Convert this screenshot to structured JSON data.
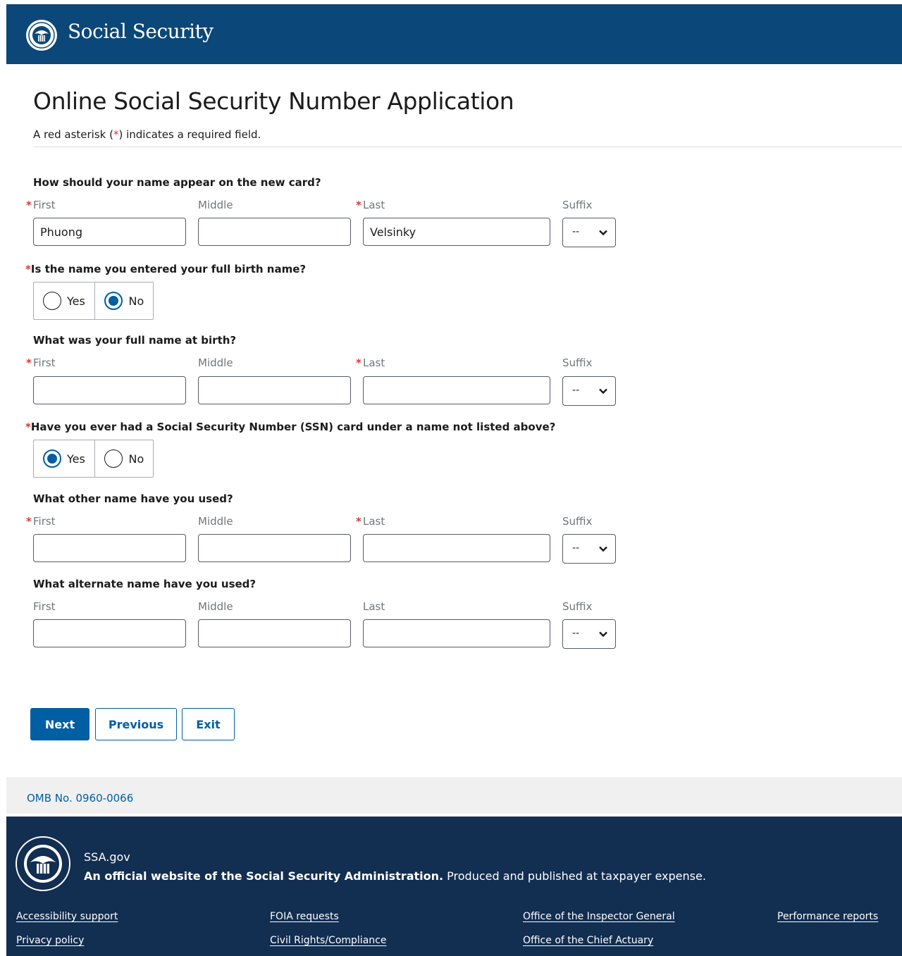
{
  "header": {
    "brand": "Social Security"
  },
  "page": {
    "title": "Online Social Security Number Application",
    "required_note_before": "A red asterisk (",
    "required_note_asterisk": "*",
    "required_note_after": ") indicates a required field."
  },
  "labels": {
    "first": "First",
    "middle": "Middle",
    "last": "Last",
    "suffix": "Suffix",
    "asterisk": "*"
  },
  "sections": {
    "card_name": {
      "question": "How should your name appear on the new card?",
      "first_value": "Phuong",
      "middle_value": "",
      "last_value": "Velsinky",
      "suffix_value": "--"
    },
    "full_birth_name": {
      "question": "Is the name you entered your full birth name?",
      "options": [
        "Yes",
        "No"
      ],
      "selected": "No"
    },
    "birth_name": {
      "question": "What was your full name at birth?",
      "first_value": "",
      "middle_value": "",
      "last_value": "",
      "suffix_value": "--"
    },
    "other_ssn_name": {
      "question": "Have you ever had a Social Security Number (SSN) card under a name not listed above?",
      "options": [
        "Yes",
        "No"
      ],
      "selected": "Yes"
    },
    "other_name": {
      "question": "What other name have you used?",
      "first_value": "",
      "middle_value": "",
      "last_value": "",
      "suffix_value": "--"
    },
    "alternate_name": {
      "question": "What alternate name have you used?",
      "first_value": "",
      "middle_value": "",
      "last_value": "",
      "suffix_value": "--"
    }
  },
  "buttons": {
    "next": "Next",
    "previous": "Previous",
    "exit": "Exit"
  },
  "omb": {
    "text": "OMB No. 0960-0066"
  },
  "footer": {
    "site": "SSA.gov",
    "official_bold": "An official website of the Social Security Administration.",
    "official_rest": " Produced and published at taxpayer expense.",
    "links": [
      "Accessibility support",
      "FOIA requests",
      "Office of the Inspector General",
      "Performance reports",
      "Privacy policy",
      "Civil Rights/Compliance",
      "Office of the Chief Actuary"
    ]
  },
  "colors": {
    "header_bg": "#0b4778",
    "footer_bg": "#122e51",
    "primary": "#005ea2",
    "required": "#d83933"
  },
  "icons": {
    "header_logo": "ssa-seal-icon",
    "footer_logo": "ssa-seal-icon",
    "select_arrow": "chevron-down-icon"
  }
}
